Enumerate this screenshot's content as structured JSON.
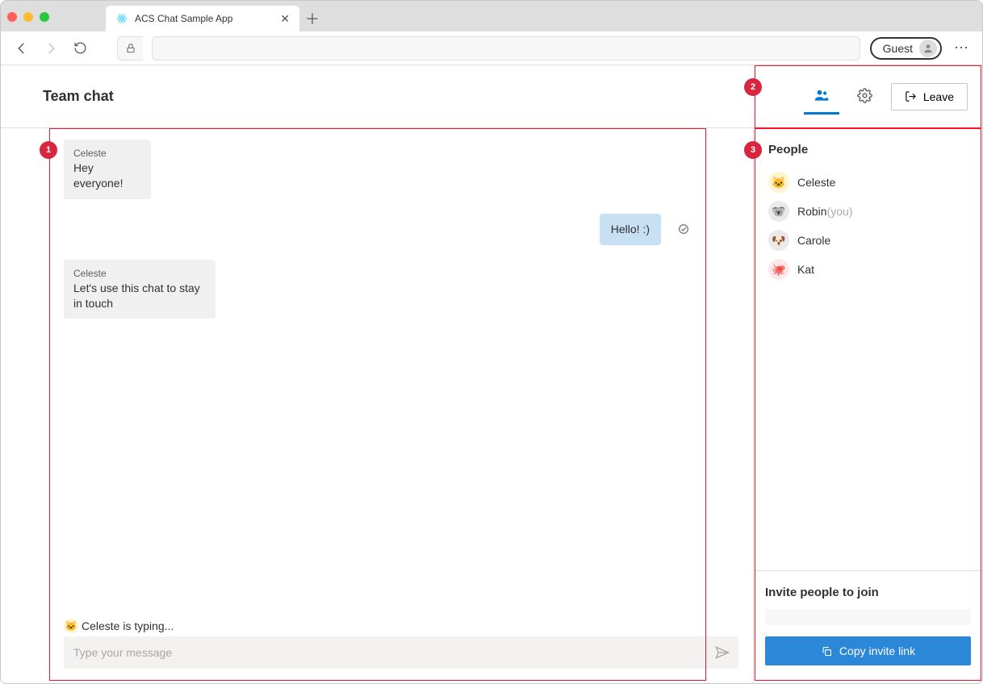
{
  "browser": {
    "tab_title": "ACS Chat Sample App",
    "guest_label": "Guest"
  },
  "header": {
    "title": "Team chat",
    "leave_label": "Leave"
  },
  "chat": {
    "messages": [
      {
        "sender": "Celeste",
        "text": "Hey everyone!",
        "self": false,
        "avatar": "🐱"
      },
      {
        "sender": "",
        "text": "Hello! :)",
        "self": true,
        "avatar": ""
      },
      {
        "sender": "Celeste",
        "text": "Let's use this chat to stay in touch",
        "self": false,
        "avatar": "🐱"
      }
    ],
    "typing_avatar": "🐱",
    "typing_text": "Celeste is typing...",
    "compose_placeholder": "Type your message"
  },
  "sidebar": {
    "people_title": "People",
    "participants": [
      {
        "name": "Celeste",
        "you": false,
        "avatar": "🐱",
        "bg": "#fff4ce"
      },
      {
        "name": "Robin",
        "you": true,
        "avatar": "🐨",
        "bg": "#eaeaea"
      },
      {
        "name": "Carole",
        "you": false,
        "avatar": "🐶",
        "bg": "#eaeaea"
      },
      {
        "name": "Kat",
        "you": false,
        "avatar": "🐙",
        "bg": "#fde7e9"
      }
    ],
    "you_suffix": "(you)",
    "invite_title": "Invite people to join",
    "copy_label": "Copy invite link"
  },
  "annotations": {
    "one": "1",
    "two": "2",
    "three": "3"
  }
}
